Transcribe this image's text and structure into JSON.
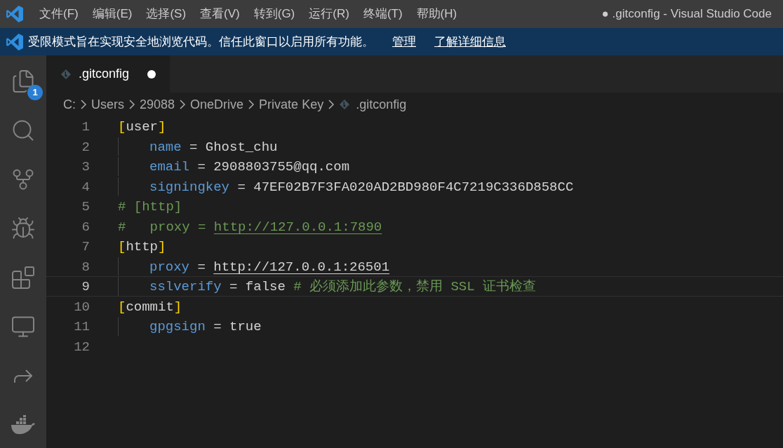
{
  "window": {
    "title": "● .gitconfig - Visual Studio Code"
  },
  "menu": [
    "文件(F)",
    "编辑(E)",
    "选择(S)",
    "查看(V)",
    "转到(G)",
    "运行(R)",
    "终端(T)",
    "帮助(H)"
  ],
  "banner": {
    "message": "受限模式旨在实现安全地浏览代码。信任此窗口以启用所有功能。",
    "links": [
      "管理",
      "了解详细信息"
    ]
  },
  "activity_bar": [
    {
      "kind": "explorer",
      "badge": "1"
    },
    {
      "kind": "search"
    },
    {
      "kind": "source-control"
    },
    {
      "kind": "debug"
    },
    {
      "kind": "extensions"
    },
    {
      "kind": "remote"
    },
    {
      "kind": "share"
    },
    {
      "kind": "docker"
    }
  ],
  "tabs": [
    {
      "label": ".gitconfig",
      "selected": true,
      "modified": true
    }
  ],
  "breadcrumbs": [
    "C:",
    "Users",
    "29088",
    "OneDrive",
    "Private Key",
    ".gitconfig"
  ],
  "editor": {
    "lines": [
      {
        "number": "1",
        "selected": false,
        "indented": false,
        "tokens": [
          {
            "kind": "bracket",
            "text": "["
          },
          {
            "kind": "plain",
            "text": "user"
          },
          {
            "kind": "bracket",
            "text": "]"
          }
        ]
      },
      {
        "number": "2",
        "selected": false,
        "indented": true,
        "tokens": [
          {
            "kind": "key",
            "text": "name"
          },
          {
            "kind": "plain",
            "text": " = Ghost_chu"
          }
        ]
      },
      {
        "number": "3",
        "selected": false,
        "indented": true,
        "tokens": [
          {
            "kind": "key",
            "text": "email"
          },
          {
            "kind": "plain",
            "text": " = 2908803755@qq.com"
          }
        ]
      },
      {
        "number": "4",
        "selected": false,
        "indented": true,
        "tokens": [
          {
            "kind": "key",
            "text": "signingkey"
          },
          {
            "kind": "plain",
            "text": " = 47EF02B7F3FA020AD2BD980F4C7219C336D858CC"
          }
        ]
      },
      {
        "number": "5",
        "selected": false,
        "indented": false,
        "tokens": [
          {
            "kind": "comment",
            "text": "# [http]"
          }
        ]
      },
      {
        "number": "6",
        "selected": false,
        "indented": false,
        "tokens": [
          {
            "kind": "comment",
            "text": "#   proxy = "
          },
          {
            "kind": "comment-link",
            "text": "http://127.0.0.1:7890"
          }
        ]
      },
      {
        "number": "7",
        "selected": false,
        "indented": false,
        "tokens": [
          {
            "kind": "bracket",
            "text": "["
          },
          {
            "kind": "plain",
            "text": "http"
          },
          {
            "kind": "bracket",
            "text": "]"
          }
        ]
      },
      {
        "number": "8",
        "selected": false,
        "indented": true,
        "tokens": [
          {
            "kind": "key",
            "text": "proxy"
          },
          {
            "kind": "plain",
            "text": " = "
          },
          {
            "kind": "link",
            "text": "http://127.0.0.1:26501"
          }
        ]
      },
      {
        "number": "9",
        "selected": true,
        "indented": true,
        "tokens": [
          {
            "kind": "key",
            "text": "sslverify"
          },
          {
            "kind": "plain",
            "text": " = false "
          },
          {
            "kind": "comment",
            "text": "# 必须添加此参数，禁用 SSL 证书检查"
          }
        ]
      },
      {
        "number": "10",
        "selected": false,
        "indented": false,
        "tokens": [
          {
            "kind": "bracket",
            "text": "["
          },
          {
            "kind": "plain",
            "text": "commit"
          },
          {
            "kind": "bracket",
            "text": "]"
          }
        ]
      },
      {
        "number": "11",
        "selected": false,
        "indented": true,
        "tokens": [
          {
            "kind": "key",
            "text": "gpgsign"
          },
          {
            "kind": "plain",
            "text": " = true"
          }
        ]
      },
      {
        "number": "12",
        "selected": false,
        "indented": false
      }
    ]
  }
}
